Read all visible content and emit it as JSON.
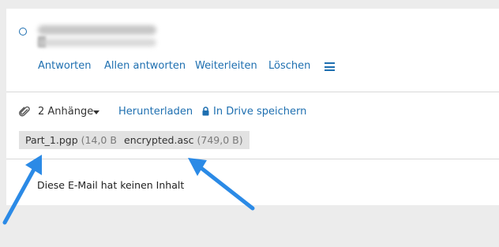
{
  "message": {
    "status_icon": "unread-circle-icon",
    "actions": {
      "reply": "Antworten",
      "reply_all": "Allen antworten",
      "forward": "Weiterleiten",
      "delete": "Löschen",
      "more_icon": "hamburger-menu-icon"
    },
    "empty_body": "Diese E-Mail hat keinen Inhalt"
  },
  "attachments": {
    "count_label": "2 Anhänge",
    "download": "Herunterladen",
    "save_to_drive": "In Drive speichern",
    "items": [
      {
        "name": "Part_1.pgp",
        "size": "(14,0 B)"
      },
      {
        "name": "encrypted.asc",
        "size": "(749,0 B)"
      }
    ]
  },
  "colors": {
    "link": "#1e6fb0",
    "annotation_arrow": "#2b8ae6",
    "chip_bg": "#e2e2e2",
    "page_bg": "#ececec"
  }
}
